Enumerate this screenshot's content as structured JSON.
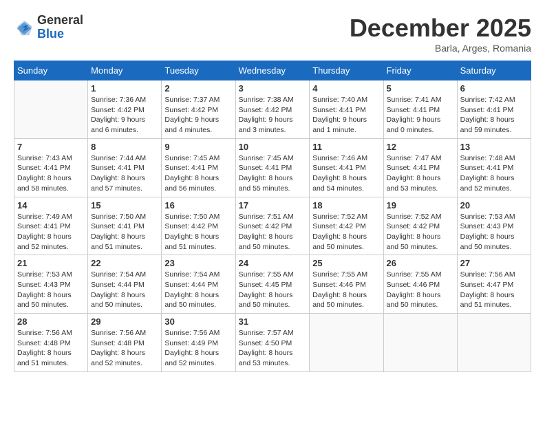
{
  "logo": {
    "general": "General",
    "blue": "Blue"
  },
  "title": "December 2025",
  "location": "Barla, Arges, Romania",
  "days_of_week": [
    "Sunday",
    "Monday",
    "Tuesday",
    "Wednesday",
    "Thursday",
    "Friday",
    "Saturday"
  ],
  "weeks": [
    [
      {
        "day": "",
        "info": ""
      },
      {
        "day": "1",
        "info": "Sunrise: 7:36 AM\nSunset: 4:42 PM\nDaylight: 9 hours\nand 6 minutes."
      },
      {
        "day": "2",
        "info": "Sunrise: 7:37 AM\nSunset: 4:42 PM\nDaylight: 9 hours\nand 4 minutes."
      },
      {
        "day": "3",
        "info": "Sunrise: 7:38 AM\nSunset: 4:42 PM\nDaylight: 9 hours\nand 3 minutes."
      },
      {
        "day": "4",
        "info": "Sunrise: 7:40 AM\nSunset: 4:41 PM\nDaylight: 9 hours\nand 1 minute."
      },
      {
        "day": "5",
        "info": "Sunrise: 7:41 AM\nSunset: 4:41 PM\nDaylight: 9 hours\nand 0 minutes."
      },
      {
        "day": "6",
        "info": "Sunrise: 7:42 AM\nSunset: 4:41 PM\nDaylight: 8 hours\nand 59 minutes."
      }
    ],
    [
      {
        "day": "7",
        "info": "Sunrise: 7:43 AM\nSunset: 4:41 PM\nDaylight: 8 hours\nand 58 minutes."
      },
      {
        "day": "8",
        "info": "Sunrise: 7:44 AM\nSunset: 4:41 PM\nDaylight: 8 hours\nand 57 minutes."
      },
      {
        "day": "9",
        "info": "Sunrise: 7:45 AM\nSunset: 4:41 PM\nDaylight: 8 hours\nand 56 minutes."
      },
      {
        "day": "10",
        "info": "Sunrise: 7:45 AM\nSunset: 4:41 PM\nDaylight: 8 hours\nand 55 minutes."
      },
      {
        "day": "11",
        "info": "Sunrise: 7:46 AM\nSunset: 4:41 PM\nDaylight: 8 hours\nand 54 minutes."
      },
      {
        "day": "12",
        "info": "Sunrise: 7:47 AM\nSunset: 4:41 PM\nDaylight: 8 hours\nand 53 minutes."
      },
      {
        "day": "13",
        "info": "Sunrise: 7:48 AM\nSunset: 4:41 PM\nDaylight: 8 hours\nand 52 minutes."
      }
    ],
    [
      {
        "day": "14",
        "info": "Sunrise: 7:49 AM\nSunset: 4:41 PM\nDaylight: 8 hours\nand 52 minutes."
      },
      {
        "day": "15",
        "info": "Sunrise: 7:50 AM\nSunset: 4:41 PM\nDaylight: 8 hours\nand 51 minutes."
      },
      {
        "day": "16",
        "info": "Sunrise: 7:50 AM\nSunset: 4:42 PM\nDaylight: 8 hours\nand 51 minutes."
      },
      {
        "day": "17",
        "info": "Sunrise: 7:51 AM\nSunset: 4:42 PM\nDaylight: 8 hours\nand 50 minutes."
      },
      {
        "day": "18",
        "info": "Sunrise: 7:52 AM\nSunset: 4:42 PM\nDaylight: 8 hours\nand 50 minutes."
      },
      {
        "day": "19",
        "info": "Sunrise: 7:52 AM\nSunset: 4:42 PM\nDaylight: 8 hours\nand 50 minutes."
      },
      {
        "day": "20",
        "info": "Sunrise: 7:53 AM\nSunset: 4:43 PM\nDaylight: 8 hours\nand 50 minutes."
      }
    ],
    [
      {
        "day": "21",
        "info": "Sunrise: 7:53 AM\nSunset: 4:43 PM\nDaylight: 8 hours\nand 50 minutes."
      },
      {
        "day": "22",
        "info": "Sunrise: 7:54 AM\nSunset: 4:44 PM\nDaylight: 8 hours\nand 50 minutes."
      },
      {
        "day": "23",
        "info": "Sunrise: 7:54 AM\nSunset: 4:44 PM\nDaylight: 8 hours\nand 50 minutes."
      },
      {
        "day": "24",
        "info": "Sunrise: 7:55 AM\nSunset: 4:45 PM\nDaylight: 8 hours\nand 50 minutes."
      },
      {
        "day": "25",
        "info": "Sunrise: 7:55 AM\nSunset: 4:46 PM\nDaylight: 8 hours\nand 50 minutes."
      },
      {
        "day": "26",
        "info": "Sunrise: 7:55 AM\nSunset: 4:46 PM\nDaylight: 8 hours\nand 50 minutes."
      },
      {
        "day": "27",
        "info": "Sunrise: 7:56 AM\nSunset: 4:47 PM\nDaylight: 8 hours\nand 51 minutes."
      }
    ],
    [
      {
        "day": "28",
        "info": "Sunrise: 7:56 AM\nSunset: 4:48 PM\nDaylight: 8 hours\nand 51 minutes."
      },
      {
        "day": "29",
        "info": "Sunrise: 7:56 AM\nSunset: 4:48 PM\nDaylight: 8 hours\nand 52 minutes."
      },
      {
        "day": "30",
        "info": "Sunrise: 7:56 AM\nSunset: 4:49 PM\nDaylight: 8 hours\nand 52 minutes."
      },
      {
        "day": "31",
        "info": "Sunrise: 7:57 AM\nSunset: 4:50 PM\nDaylight: 8 hours\nand 53 minutes."
      },
      {
        "day": "",
        "info": ""
      },
      {
        "day": "",
        "info": ""
      },
      {
        "day": "",
        "info": ""
      }
    ]
  ]
}
